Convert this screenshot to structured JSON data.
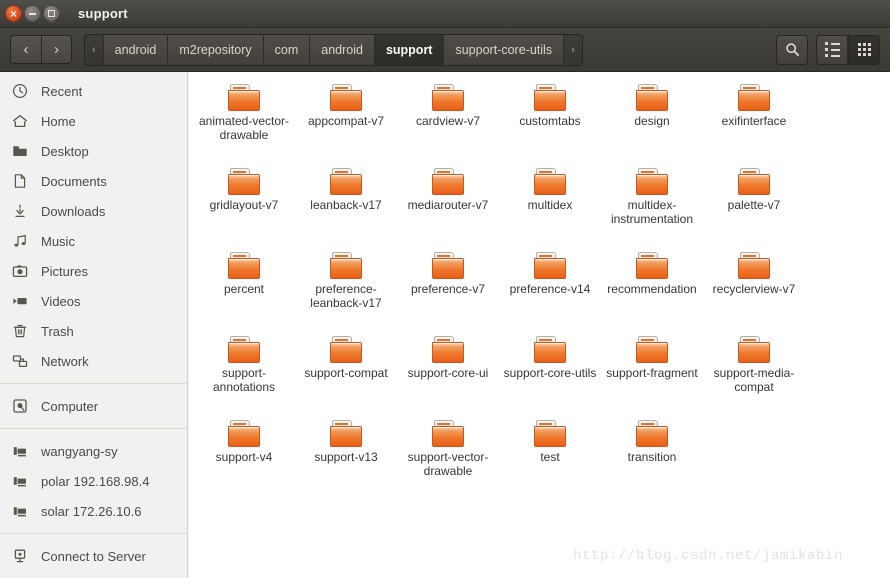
{
  "window": {
    "title": "support",
    "controls": [
      {
        "name": "close",
        "icon": "close-icon"
      },
      {
        "name": "minimize",
        "icon": "minimize-icon"
      },
      {
        "name": "maximize",
        "icon": "maximize-icon"
      }
    ]
  },
  "toolbar": {
    "back_label": "‹",
    "forward_label": "›",
    "prev_crumb_label": "‹",
    "next_crumb_label": "›",
    "search_icon": "search-icon",
    "list_view_icon": "list-view-icon",
    "grid_view_icon": "grid-view-icon",
    "active_view": "grid",
    "breadcrumbs": [
      {
        "label": "android",
        "active": false
      },
      {
        "label": "m2repository",
        "active": false
      },
      {
        "label": "com",
        "active": false
      },
      {
        "label": "android",
        "active": false
      },
      {
        "label": "support",
        "active": true
      },
      {
        "label": "support-core-utils",
        "active": false
      }
    ]
  },
  "sidebar": {
    "groups": [
      {
        "items": [
          {
            "label": "Recent",
            "icon": "clock-icon"
          },
          {
            "label": "Home",
            "icon": "home-icon"
          },
          {
            "label": "Desktop",
            "icon": "desktop-folder-icon"
          },
          {
            "label": "Documents",
            "icon": "document-icon"
          },
          {
            "label": "Downloads",
            "icon": "download-icon"
          },
          {
            "label": "Music",
            "icon": "music-note-icon"
          },
          {
            "label": "Pictures",
            "icon": "camera-icon"
          },
          {
            "label": "Videos",
            "icon": "video-icon"
          },
          {
            "label": "Trash",
            "icon": "trash-icon"
          },
          {
            "label": "Network",
            "icon": "network-icon"
          }
        ]
      },
      {
        "items": [
          {
            "label": "Computer",
            "icon": "computer-disk-icon"
          }
        ]
      },
      {
        "items": [
          {
            "label": "wangyang-sy",
            "icon": "server-icon"
          },
          {
            "label": "polar 192.168.98.4",
            "icon": "server-icon"
          },
          {
            "label": "solar 172.26.10.6",
            "icon": "server-icon"
          }
        ]
      },
      {
        "items": [
          {
            "label": "Connect to Server",
            "icon": "connect-server-icon"
          }
        ]
      }
    ]
  },
  "files": [
    {
      "name": "animated-vector-drawable",
      "icon": "folder-icon"
    },
    {
      "name": "appcompat-v7",
      "icon": "folder-icon"
    },
    {
      "name": "cardview-v7",
      "icon": "folder-icon"
    },
    {
      "name": "customtabs",
      "icon": "folder-icon"
    },
    {
      "name": "design",
      "icon": "folder-icon"
    },
    {
      "name": "exifinterface",
      "icon": "folder-icon"
    },
    {
      "name": "gridlayout-v7",
      "icon": "folder-icon"
    },
    {
      "name": "leanback-v17",
      "icon": "folder-icon"
    },
    {
      "name": "mediarouter-v7",
      "icon": "folder-icon"
    },
    {
      "name": "multidex",
      "icon": "folder-icon"
    },
    {
      "name": "multidex-instrumentation",
      "icon": "folder-icon"
    },
    {
      "name": "palette-v7",
      "icon": "folder-icon"
    },
    {
      "name": "percent",
      "icon": "folder-icon"
    },
    {
      "name": "preference-leanback-v17",
      "icon": "folder-icon"
    },
    {
      "name": "preference-v7",
      "icon": "folder-icon"
    },
    {
      "name": "preference-v14",
      "icon": "folder-icon"
    },
    {
      "name": "recommendation",
      "icon": "folder-icon"
    },
    {
      "name": "recyclerview-v7",
      "icon": "folder-icon"
    },
    {
      "name": "support-annotations",
      "icon": "folder-icon"
    },
    {
      "name": "support-compat",
      "icon": "folder-icon"
    },
    {
      "name": "support-core-ui",
      "icon": "folder-icon"
    },
    {
      "name": "support-core-utils",
      "icon": "folder-icon"
    },
    {
      "name": "support-fragment",
      "icon": "folder-icon"
    },
    {
      "name": "support-media-compat",
      "icon": "folder-icon"
    },
    {
      "name": "support-v4",
      "icon": "folder-icon"
    },
    {
      "name": "support-v13",
      "icon": "folder-icon"
    },
    {
      "name": "support-vector-drawable",
      "icon": "folder-icon"
    },
    {
      "name": "test",
      "icon": "folder-icon"
    },
    {
      "name": "transition",
      "icon": "folder-icon"
    }
  ],
  "watermark": {
    "text": "http://blog.csdn.net/jamikabin"
  },
  "colors": {
    "folder_orange": "#ef7b2f",
    "titlebar_dark": "#3c3b37",
    "sidebar_bg": "#f2f1f0",
    "content_bg": "#ffffff",
    "close_button": "#d64817"
  }
}
